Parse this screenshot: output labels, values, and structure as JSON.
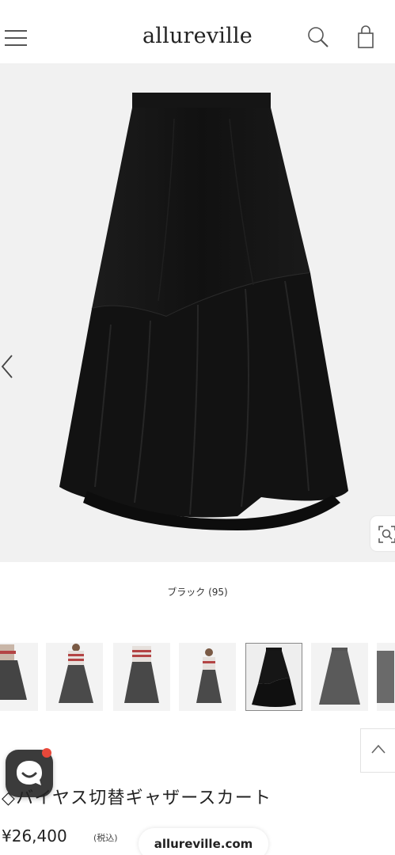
{
  "header": {
    "logo": "allureville",
    "menu_icon": "hamburger-menu-icon",
    "search_icon": "search-icon",
    "cart_icon": "shopping-bag-icon"
  },
  "product_image": {
    "color_label": "ブラック (95)",
    "prev_icon": "chevron-left-icon",
    "zoom_icon": "zoom-icon"
  },
  "thumbnails": [
    {
      "label": "",
      "selected": false
    },
    {
      "label": "",
      "selected": false
    },
    {
      "label": "",
      "selected": false
    },
    {
      "label": "",
      "selected": false
    },
    {
      "label": "",
      "selected": true
    },
    {
      "label": "",
      "selected": false
    },
    {
      "label": "",
      "selected": false
    }
  ],
  "product": {
    "title": "◇バイヤス切替ギャザースカート",
    "price": "¥26,400",
    "tax_note": "(税込)"
  },
  "browser": {
    "url": "allureville.com"
  },
  "colors": {
    "skirt": "#141414",
    "background": "#f1f1f1",
    "chat_badge": "#e8483a"
  }
}
